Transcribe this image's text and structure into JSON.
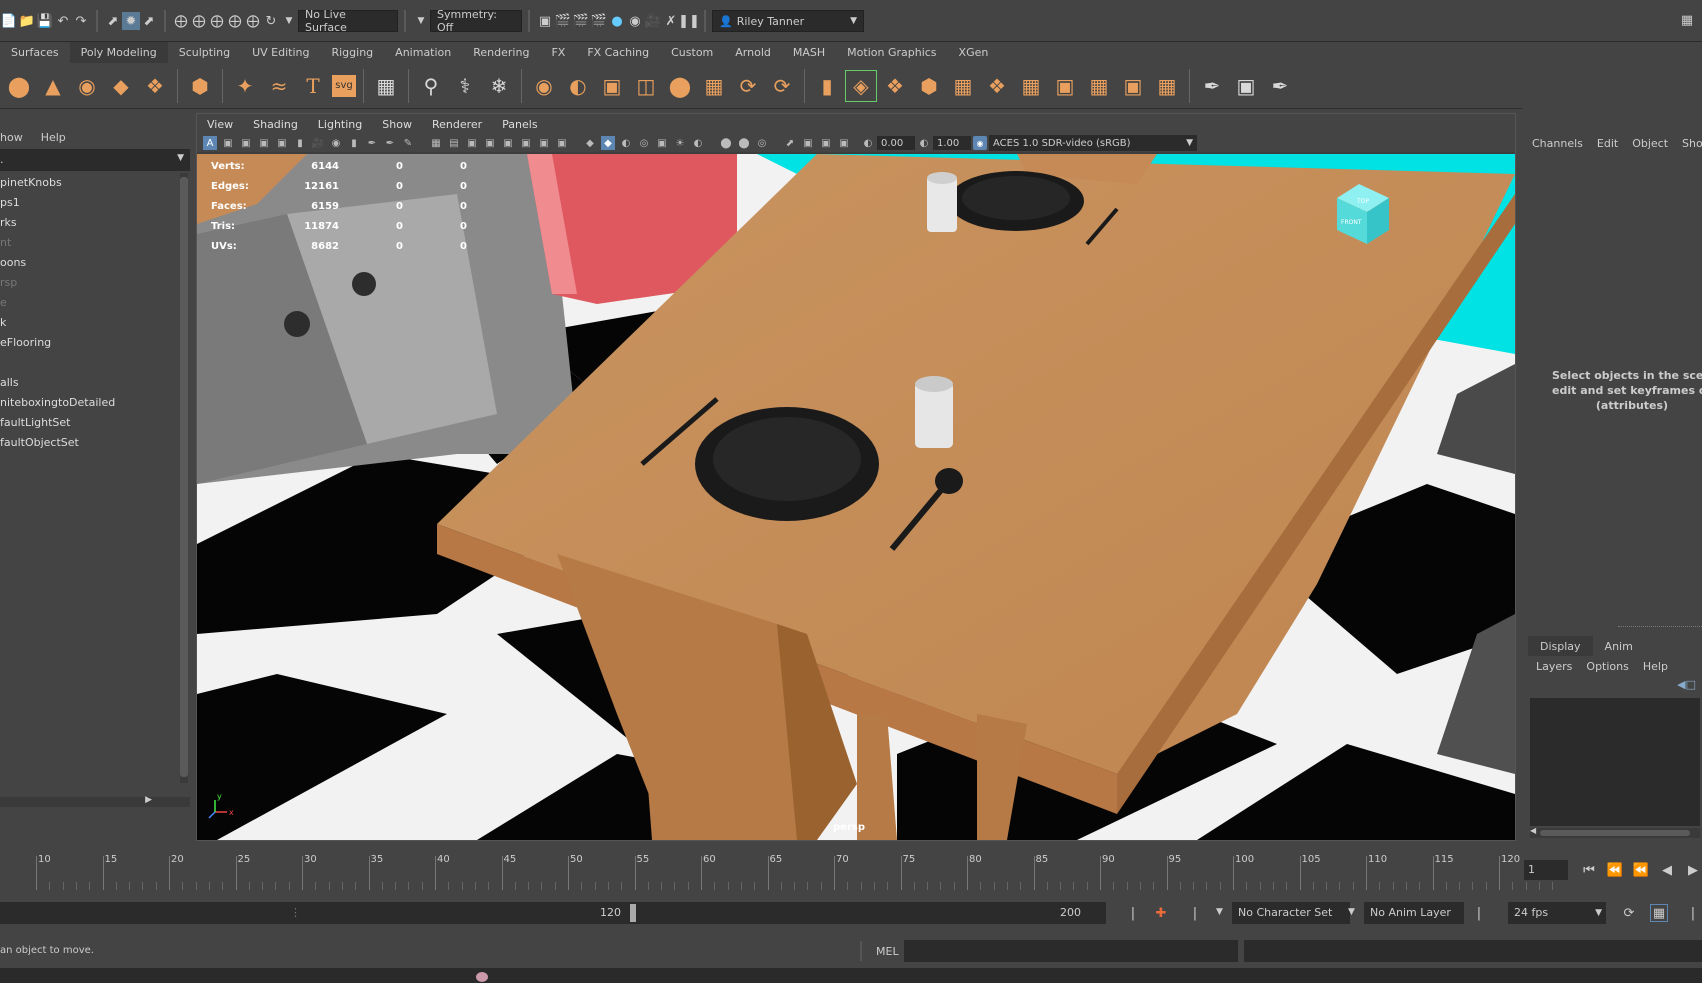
{
  "status_line": {
    "live_surface": "No Live Surface",
    "symmetry": "Symmetry: Off",
    "user": "Riley Tanner"
  },
  "menu_sets": [
    "Surfaces",
    "Poly Modeling",
    "Sculpting",
    "UV Editing",
    "Rigging",
    "Animation",
    "Rendering",
    "FX",
    "FX Caching",
    "Custom",
    "Arnold",
    "MASH",
    "Motion Graphics",
    "XGen"
  ],
  "outliner": {
    "menu": [
      "how",
      "Help"
    ],
    "items": [
      {
        "label": "pinetKnobs",
        "dim": false
      },
      {
        "label": "ps1",
        "dim": false
      },
      {
        "label": "rks",
        "dim": false
      },
      {
        "label": "nt",
        "dim": true
      },
      {
        "label": "oons",
        "dim": false
      },
      {
        "label": "rsp",
        "dim": true
      },
      {
        "label": "e",
        "dim": true
      },
      {
        "label": "k",
        "dim": false
      },
      {
        "label": "eFlooring",
        "dim": false
      },
      {
        "label": "",
        "dim": true
      },
      {
        "label": "alls",
        "dim": false
      },
      {
        "label": "niteboxingtoDetailed",
        "dim": false
      },
      {
        "label": "faultLightSet",
        "dim": false
      },
      {
        "label": "faultObjectSet",
        "dim": false
      }
    ]
  },
  "viewport": {
    "menu": [
      "View",
      "Shading",
      "Lighting",
      "Show",
      "Renderer",
      "Panels"
    ],
    "exposure": "0.00",
    "gamma": "1.00",
    "color_space": "ACES 1.0 SDR-video (sRGB)",
    "camera": "persp",
    "hud": [
      {
        "label": "Verts:",
        "v": "6144",
        "a": "0",
        "b": "0"
      },
      {
        "label": "Edges:",
        "v": "12161",
        "a": "0",
        "b": "0"
      },
      {
        "label": "Faces:",
        "v": "6159",
        "a": "0",
        "b": "0"
      },
      {
        "label": "Tris:",
        "v": "11874",
        "a": "0",
        "b": "0"
      },
      {
        "label": "UVs:",
        "v": "8682",
        "a": "0",
        "b": "0"
      }
    ],
    "cube_top": "TOP",
    "cube_front": "FRONT"
  },
  "channel_box": {
    "menu": [
      "Channels",
      "Edit",
      "Object",
      "Show"
    ],
    "message_l1": "Select objects in the scene t",
    "message_l2": "edit and set keyframes on c",
    "message_l3": "(attributes)"
  },
  "layer_editor": {
    "tabs": [
      "Display",
      "Anim"
    ],
    "menu": [
      "Layers",
      "Options",
      "Help"
    ]
  },
  "time_slider": {
    "ticks": [
      "10",
      "15",
      "20",
      "25",
      "30",
      "35",
      "40",
      "45",
      "50",
      "55",
      "60",
      "65",
      "70",
      "75",
      "80",
      "85",
      "90",
      "95",
      "100",
      "105",
      "110",
      "115",
      "120"
    ],
    "current_frame": "1"
  },
  "range_slider": {
    "range_end": "120",
    "anim_end": "200",
    "character_set": "No Character Set",
    "anim_layer": "No Anim Layer",
    "fps": "24 fps"
  },
  "command_line": {
    "help_text": "an object to move.",
    "lang": "MEL"
  },
  "colors": {
    "accent_orange": "#e9a05e",
    "table": "#c58a56",
    "wall_cyan": "#00e0e0",
    "fridge": "#e25a62"
  }
}
